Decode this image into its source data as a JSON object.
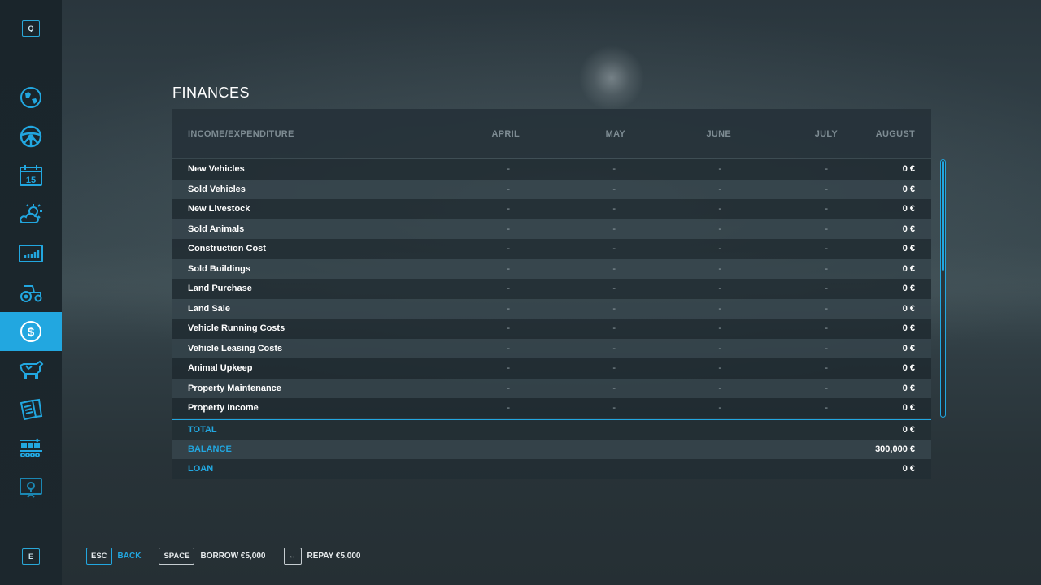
{
  "sidebar": {
    "top_key": "Q",
    "bottom_key": "E",
    "items": [
      {
        "name": "map",
        "icon": "globe-map-icon",
        "active": false
      },
      {
        "name": "vehicles",
        "icon": "steering-wheel-icon",
        "active": false
      },
      {
        "name": "calendar",
        "icon": "calendar-icon",
        "active": false,
        "badge": "15"
      },
      {
        "name": "weather",
        "icon": "weather-sun-cloud-icon",
        "active": false
      },
      {
        "name": "prices",
        "icon": "price-chart-icon",
        "active": false
      },
      {
        "name": "tractor",
        "icon": "tractor-icon",
        "active": false
      },
      {
        "name": "finances",
        "icon": "dollar-coin-icon",
        "active": true
      },
      {
        "name": "animals",
        "icon": "cow-icon",
        "active": false
      },
      {
        "name": "contracts",
        "icon": "contracts-icon",
        "active": false
      },
      {
        "name": "production",
        "icon": "production-chain-icon",
        "active": false
      },
      {
        "name": "help",
        "icon": "help-display-icon",
        "active": false
      }
    ]
  },
  "page": {
    "title": "FINANCES"
  },
  "table": {
    "headers": [
      "INCOME/EXPENDITURE",
      "APRIL",
      "MAY",
      "JUNE",
      "JULY",
      "AUGUST"
    ],
    "rows": [
      {
        "label": "New Vehicles",
        "values": [
          "-",
          "-",
          "-",
          "-",
          "0 €"
        ]
      },
      {
        "label": "Sold Vehicles",
        "values": [
          "-",
          "-",
          "-",
          "-",
          "0 €"
        ]
      },
      {
        "label": "New Livestock",
        "values": [
          "-",
          "-",
          "-",
          "-",
          "0 €"
        ]
      },
      {
        "label": "Sold Animals",
        "values": [
          "-",
          "-",
          "-",
          "-",
          "0 €"
        ]
      },
      {
        "label": "Construction Cost",
        "values": [
          "-",
          "-",
          "-",
          "-",
          "0 €"
        ]
      },
      {
        "label": "Sold Buildings",
        "values": [
          "-",
          "-",
          "-",
          "-",
          "0 €"
        ]
      },
      {
        "label": "Land Purchase",
        "values": [
          "-",
          "-",
          "-",
          "-",
          "0 €"
        ]
      },
      {
        "label": "Land Sale",
        "values": [
          "-",
          "-",
          "-",
          "-",
          "0 €"
        ]
      },
      {
        "label": "Vehicle Running Costs",
        "values": [
          "-",
          "-",
          "-",
          "-",
          "0 €"
        ]
      },
      {
        "label": "Vehicle Leasing Costs",
        "values": [
          "-",
          "-",
          "-",
          "-",
          "0 €"
        ]
      },
      {
        "label": "Animal Upkeep",
        "values": [
          "-",
          "-",
          "-",
          "-",
          "0 €"
        ]
      },
      {
        "label": "Property Maintenance",
        "values": [
          "-",
          "-",
          "-",
          "-",
          "0 €"
        ]
      },
      {
        "label": "Property Income",
        "values": [
          "-",
          "-",
          "-",
          "-",
          "0 €"
        ]
      }
    ],
    "summary": [
      {
        "label": "TOTAL",
        "value": "0 €"
      },
      {
        "label": "BALANCE",
        "value": "300,000 €"
      },
      {
        "label": "LOAN",
        "value": "0 €"
      }
    ],
    "scroll_fraction_visible": 0.43
  },
  "hints": [
    {
      "key": "ESC",
      "label": "BACK",
      "accent": true
    },
    {
      "key": "SPACE",
      "label": "BORROW €5,000",
      "accent": false
    },
    {
      "key": "↔",
      "label": "REPAY €5,000",
      "accent": false
    }
  ],
  "colors": {
    "accent": "#22a7e0",
    "header_text": "#7e8c93",
    "row_text": "#ffffff"
  }
}
